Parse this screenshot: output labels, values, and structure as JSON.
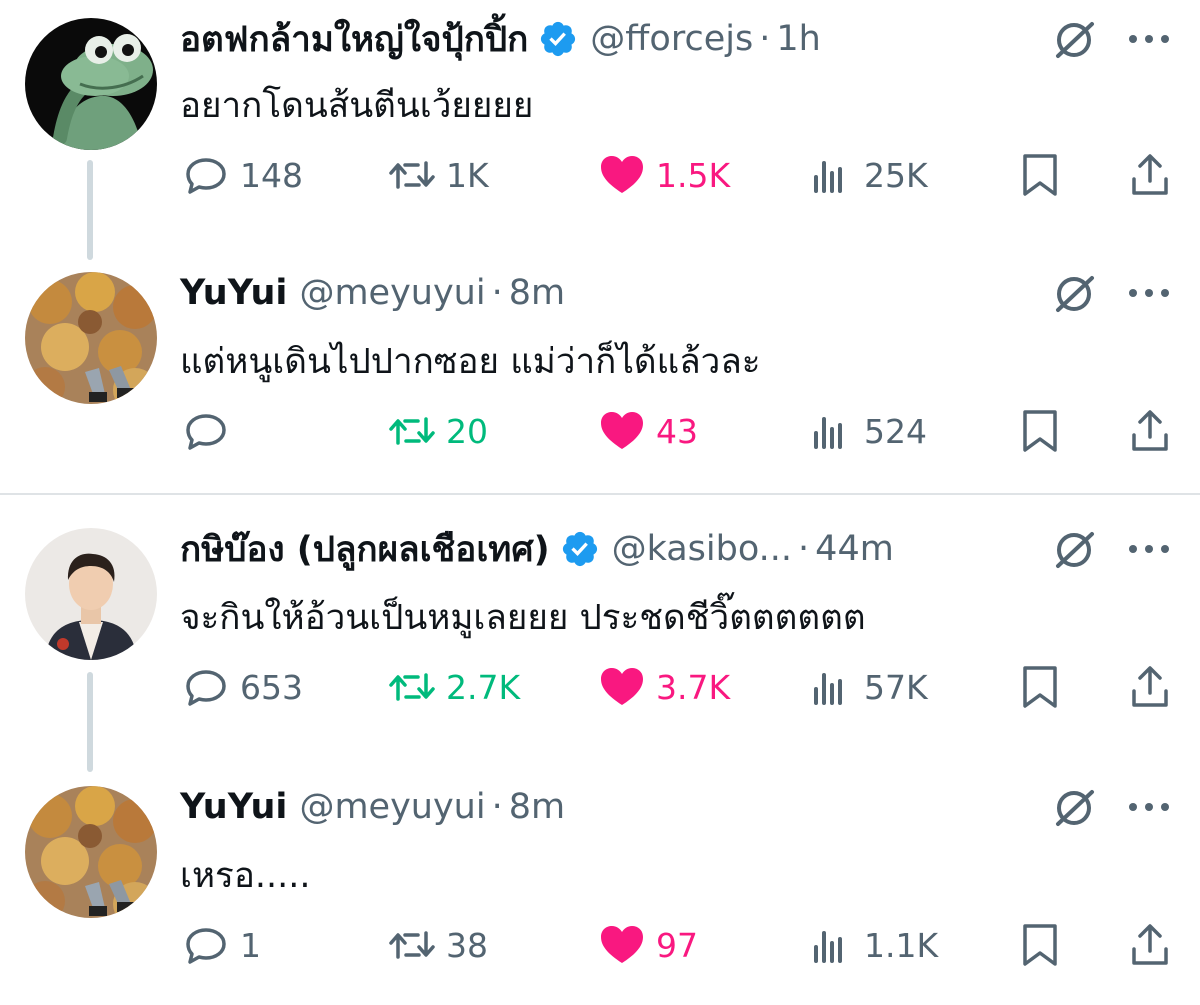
{
  "colors": {
    "text": "#0f1419",
    "muted": "#536471",
    "retweet_active": "#00ba7c",
    "like_active": "#f91880",
    "verified": "#1d9bf0",
    "divider": "#dfe3e6"
  },
  "tweets": [
    {
      "name": "อตฟกล้ามใหญ่ใจปุ้กปิ้ก",
      "verified": true,
      "handle": "@fforcejs",
      "dot": "·",
      "time": "1h",
      "text": "อยากโดนส้นตีนเว้ยยยย",
      "avatar_icon": "frog-avatar-icon",
      "stats": {
        "replies": "148",
        "retweets": "1K",
        "likes": "1.5K",
        "views": "25K"
      },
      "retweeted": false,
      "liked": true
    },
    {
      "name": "YuYui",
      "verified": false,
      "handle": "@meyuyui",
      "dot": "·",
      "time": "8m",
      "text": "แต่หนูเดินไปปากซอย แม่ว่าก็ได้แล้วละ",
      "avatar_icon": "autumn-leaves-avatar-icon",
      "stats": {
        "replies": "",
        "retweets": "20",
        "likes": "43",
        "views": "524"
      },
      "retweeted": true,
      "liked": true
    },
    {
      "name": "กษิบ๊อง (ปลูกผลเชือเทศ)",
      "verified": true,
      "handle": "@kasibo...",
      "dot": "·",
      "time": "44m",
      "text": "จะกินให้อ้วนเป็นหมูเลยยย ประชดชีวิ๊ตตตตตต",
      "avatar_icon": "person-avatar-icon",
      "stats": {
        "replies": "653",
        "retweets": "2.7K",
        "likes": "3.7K",
        "views": "57K"
      },
      "retweeted": true,
      "liked": true
    },
    {
      "name": "YuYui",
      "verified": false,
      "handle": "@meyuyui",
      "dot": "·",
      "time": "8m",
      "text": "เหรอ.....",
      "avatar_icon": "autumn-leaves-avatar-icon",
      "stats": {
        "replies": "1",
        "retweets": "38",
        "likes": "97",
        "views": "1.1K"
      },
      "retweeted": false,
      "liked": true
    }
  ]
}
